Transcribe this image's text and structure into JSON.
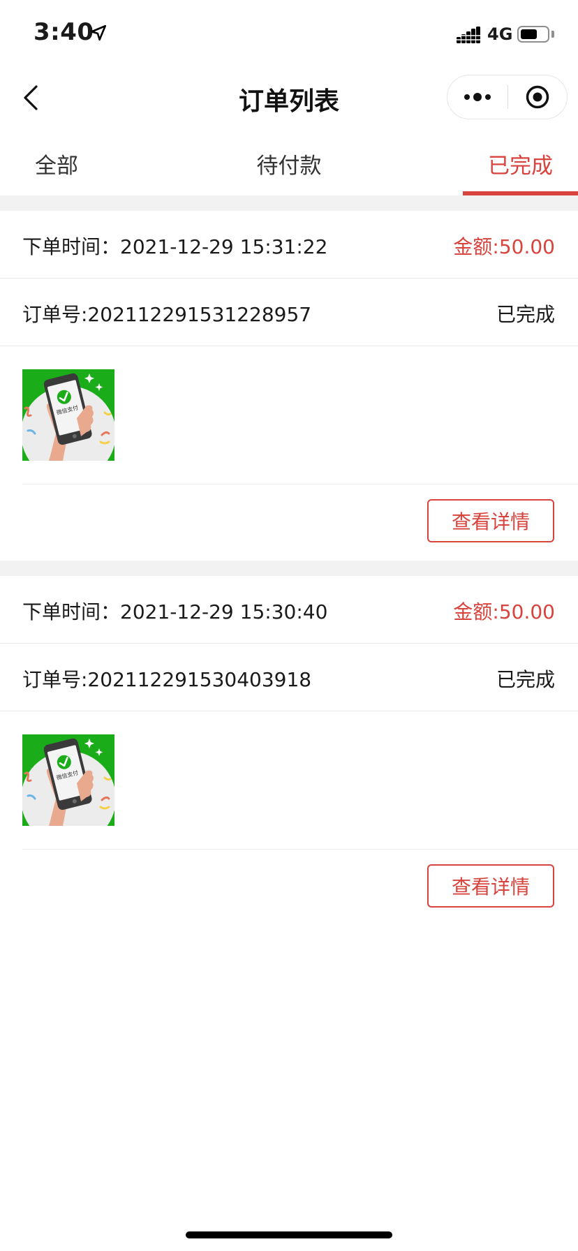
{
  "status_bar": {
    "time": "3:40",
    "network": "4G",
    "battery_level": 0.65
  },
  "nav": {
    "title": "订单列表"
  },
  "tabs": [
    {
      "label": "全部",
      "active": false
    },
    {
      "label": "待付款",
      "active": false
    },
    {
      "label": "已完成",
      "active": true
    }
  ],
  "colors": {
    "accent": "#d9433d",
    "wechat_green": "#1aad19",
    "band_gray": "#f2f2f2"
  },
  "orders": [
    {
      "time_label": "下单时间：",
      "time": "2021-12-29 15:31:22",
      "amount": "金额:50.00",
      "order_no": "订单号:202112291531228957",
      "status": "已完成",
      "product_image": "wechat-pay-phone-image",
      "product_image_text": "微信支付",
      "detail_button": "查看详情"
    },
    {
      "time_label": "下单时间：",
      "time": "2021-12-29 15:30:40",
      "amount": "金额:50.00",
      "order_no": "订单号:202112291530403918",
      "status": "已完成",
      "product_image": "wechat-pay-phone-image",
      "product_image_text": "微信支付",
      "detail_button": "查看详情"
    }
  ],
  "icons": {
    "back": "chevron-left-icon",
    "more": "more-dots-icon",
    "close": "target-close-icon",
    "location": "location-arrow-icon",
    "signal": "cellular-signal-icon",
    "battery": "battery-icon"
  }
}
